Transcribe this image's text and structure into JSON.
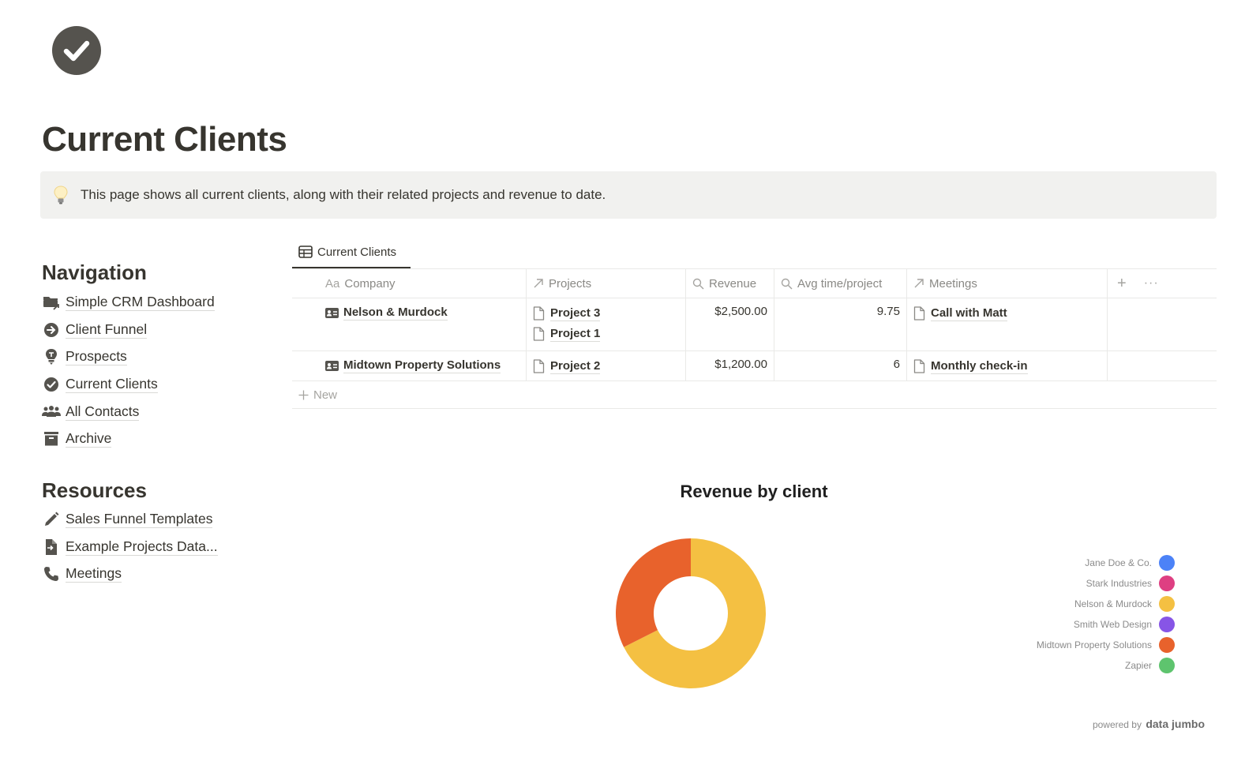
{
  "page": {
    "icon": "check-circle-icon",
    "title": "Current Clients",
    "callout": {
      "icon": "lightbulb-icon",
      "text": "This page shows all current clients, along with their related projects and revenue to date."
    }
  },
  "navigation": {
    "heading": "Navigation",
    "items": [
      {
        "label": "Simple CRM Dashboard",
        "icon": "folder-link-icon"
      },
      {
        "label": "Client Funnel",
        "icon": "arrow-circle-icon"
      },
      {
        "label": "Prospects",
        "icon": "lightbulb-icon"
      },
      {
        "label": "Current Clients",
        "icon": "check-circle-icon"
      },
      {
        "label": "All Contacts",
        "icon": "people-icon"
      },
      {
        "label": "Archive",
        "icon": "archive-icon"
      }
    ]
  },
  "resources": {
    "heading": "Resources",
    "items": [
      {
        "label": "Sales Funnel Templates",
        "icon": "pencil-icon"
      },
      {
        "label": "Example Projects Data...",
        "icon": "document-import-icon"
      },
      {
        "label": "Meetings",
        "icon": "phone-icon"
      }
    ]
  },
  "database": {
    "tab_label": "Current Clients",
    "columns": [
      {
        "label": "Company",
        "icon": "text-icon",
        "icon_text": "Aa"
      },
      {
        "label": "Projects",
        "icon": "relation-arrow-icon"
      },
      {
        "label": "Revenue",
        "icon": "rollup-search-icon"
      },
      {
        "label": "Avg time/project",
        "icon": "rollup-search-icon"
      },
      {
        "label": "Meetings",
        "icon": "relation-arrow-icon"
      }
    ],
    "rows": [
      {
        "company": "Nelson & Murdock",
        "projects": [
          "Project 3",
          "Project 1"
        ],
        "revenue": "$2,500.00",
        "avg_time": "9.75",
        "meetings": [
          "Call with Matt"
        ]
      },
      {
        "company": "Midtown Property Solutions",
        "projects": [
          "Project 2"
        ],
        "revenue": "$1,200.00",
        "avg_time": "6",
        "meetings": [
          "Monthly check-in"
        ]
      }
    ],
    "new_label": "New"
  },
  "chart_data": {
    "type": "pie",
    "variant": "donut",
    "title": "Revenue by client",
    "slices": [
      {
        "label": "Nelson & Murdock",
        "value": 2500,
        "color": "#f4c042"
      },
      {
        "label": "Midtown Property Solutions",
        "value": 1200,
        "color": "#e8622c"
      }
    ],
    "legend": [
      {
        "label": "Jane Doe & Co.",
        "color": "#4c82f7"
      },
      {
        "label": "Stark Industries",
        "color": "#de3f82"
      },
      {
        "label": "Nelson & Murdock",
        "color": "#f4c042"
      },
      {
        "label": "Smith Web Design",
        "color": "#8755e6"
      },
      {
        "label": "Midtown Property Solutions",
        "color": "#e8622c"
      },
      {
        "label": "Zapier",
        "color": "#5ec46e"
      }
    ],
    "legend_position": "right"
  },
  "footer": {
    "powered_by": "powered by",
    "brand": "data jumbo"
  }
}
